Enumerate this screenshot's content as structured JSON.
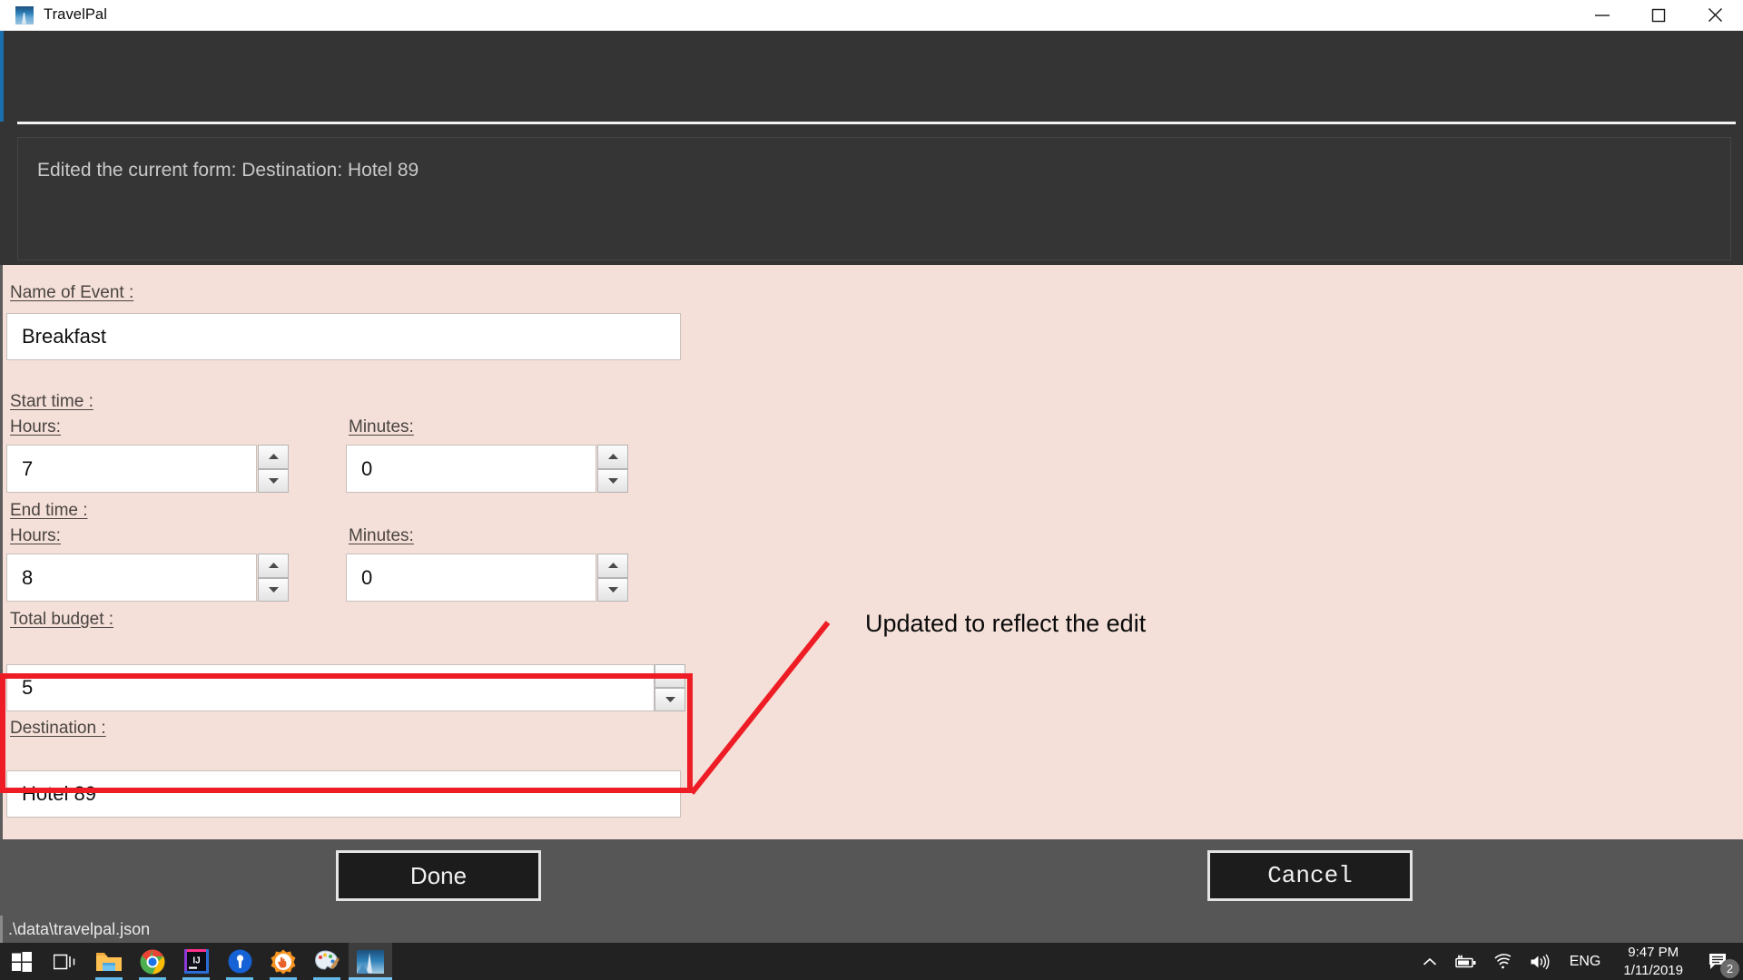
{
  "window": {
    "title": "TravelPal",
    "icon": "photo-icon",
    "controls": {
      "minimize": "minimize-icon",
      "maximize": "maximize-icon",
      "close": "close-icon"
    }
  },
  "log": {
    "message": "Edited the current form: Destination: Hotel 89"
  },
  "form": {
    "fields": [
      {
        "label": "Name of Event : ",
        "value": "Breakfast"
      },
      {
        "label": "Start time : "
      },
      {
        "label": "Hours:",
        "value": "7"
      },
      {
        "label": "Minutes:",
        "value": "0"
      },
      {
        "label": "End time : "
      },
      {
        "label": "Hours:",
        "value": "8"
      },
      {
        "label": "Minutes:",
        "value": "0"
      },
      {
        "label": "Total budget : ",
        "value": "5"
      },
      {
        "label": "Destination : ",
        "value": "Hotel 89"
      }
    ]
  },
  "annotation": {
    "text": "Updated to reflect the edit",
    "color": "#ee1c25"
  },
  "buttons": {
    "done": "Done",
    "cancel": "Cancel"
  },
  "statusbar": {
    "path": ".\\data\\travelpal.json"
  },
  "taskbar": {
    "items": [
      {
        "name": "start-icon"
      },
      {
        "name": "task-view-icon"
      },
      {
        "name": "file-explorer-icon"
      },
      {
        "name": "chrome-icon"
      },
      {
        "name": "intellij-idea-icon"
      },
      {
        "name": "location-pin-icon"
      },
      {
        "name": "cursor-app-icon"
      },
      {
        "name": "paint-icon"
      },
      {
        "name": "travelpal-icon"
      }
    ],
    "tray": {
      "chevron": "chevron-up-icon",
      "battery": "battery-charging-icon",
      "wifi": "wifi-icon",
      "volume": "volume-icon",
      "language": "ENG",
      "time": "9:47 PM",
      "date": "1/11/2019",
      "notifications": "notifications-icon",
      "notification_count": "2"
    }
  }
}
